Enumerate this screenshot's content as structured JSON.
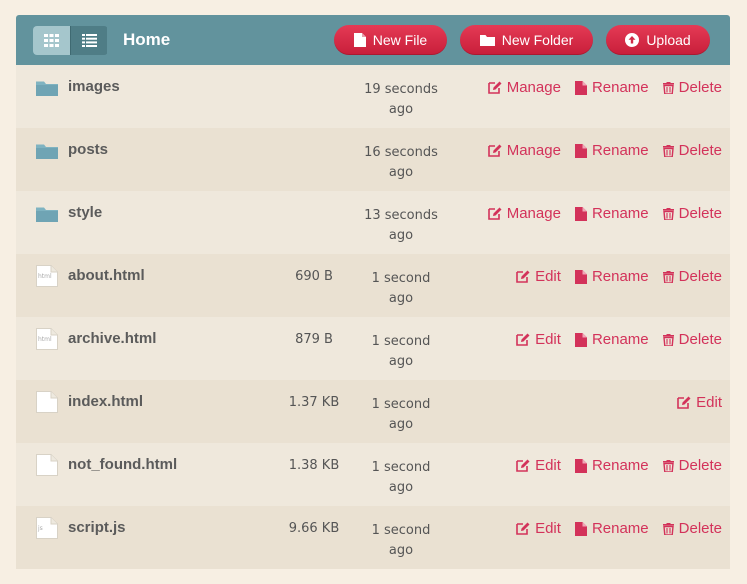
{
  "toolbar": {
    "title": "Home",
    "buttons": {
      "new_file": "New File",
      "new_folder": "New Folder",
      "upload": "Upload"
    }
  },
  "colors": {
    "toolbar": "#62939d",
    "accent": "#d3325a",
    "folder": "#7fb3c1"
  },
  "files": [
    {
      "name": "images",
      "type": "folder",
      "size": "",
      "modified": [
        "19 seconds",
        "ago"
      ],
      "actions": [
        "Manage",
        "Rename",
        "Delete"
      ]
    },
    {
      "name": "posts",
      "type": "folder",
      "size": "",
      "modified": [
        "16 seconds",
        "ago"
      ],
      "actions": [
        "Manage",
        "Rename",
        "Delete"
      ]
    },
    {
      "name": "style",
      "type": "folder",
      "size": "",
      "modified": [
        "13 seconds",
        "ago"
      ],
      "actions": [
        "Manage",
        "Rename",
        "Delete"
      ]
    },
    {
      "name": "about.html",
      "type": "html",
      "size": "690 B",
      "modified": [
        "1 second",
        "ago"
      ],
      "actions": [
        "Edit",
        "Rename",
        "Delete"
      ]
    },
    {
      "name": "archive.html",
      "type": "html",
      "size": "879 B",
      "modified": [
        "1 second",
        "ago"
      ],
      "actions": [
        "Edit",
        "Rename",
        "Delete"
      ]
    },
    {
      "name": "index.html",
      "type": "file",
      "size": "1.37 KB",
      "modified": [
        "1 second",
        "ago"
      ],
      "actions": [
        "Edit"
      ]
    },
    {
      "name": "not_found.html",
      "type": "file",
      "size": "1.38 KB",
      "modified": [
        "1 second",
        "ago"
      ],
      "actions": [
        "Edit",
        "Rename",
        "Delete"
      ]
    },
    {
      "name": "script.js",
      "type": "js",
      "size": "9.66 KB",
      "modified": [
        "1 second",
        "ago"
      ],
      "actions": [
        "Edit",
        "Rename",
        "Delete"
      ]
    }
  ],
  "file_icon_labels": {
    "html": "html",
    "js": "js"
  }
}
